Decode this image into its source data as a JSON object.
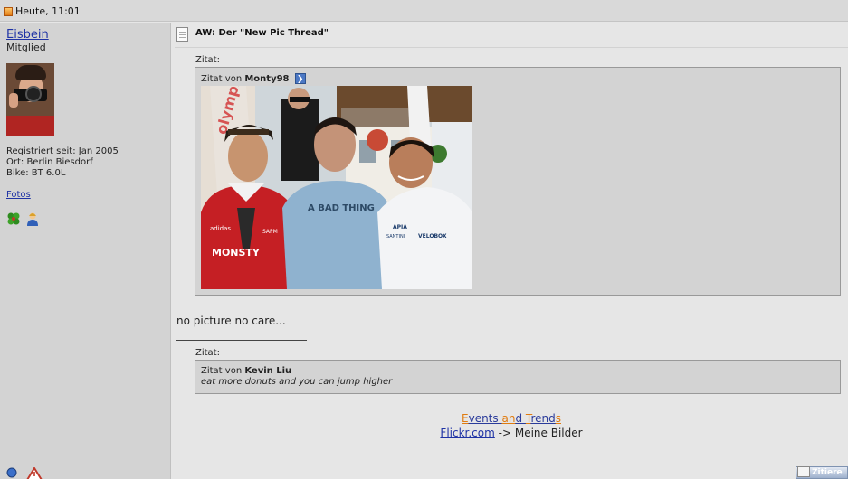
{
  "post_header": {
    "timestamp": "Heute, 11:01"
  },
  "user": {
    "name": "Eisbein",
    "rank": "Mitglied",
    "info": [
      "Registriert seit: Jan 2005",
      "Ort: Berlin Biesdorf",
      "Bike: BT 6.0L"
    ],
    "fotos_label": "Fotos"
  },
  "post": {
    "title": "AW: Der \"New Pic Thread\"",
    "quote1": {
      "label": "Zitat:",
      "prefix": "Zitat von",
      "author": "Monty98"
    },
    "body": "no picture no care...",
    "quote2": {
      "label": "Zitat:",
      "prefix": "Zitat von",
      "author": "Kevin Liu",
      "text": "eat more donuts and you can jump higher"
    }
  },
  "signature": {
    "events": [
      {
        "t": "E",
        "c": "#e07b0f"
      },
      {
        "t": "vents ",
        "c": "#2a3b9b"
      },
      {
        "t": "an",
        "c": "#e07b0f"
      },
      {
        "t": "d ",
        "c": "#2a3b9b"
      },
      {
        "t": "T",
        "c": "#e07b0f"
      },
      {
        "t": "rend",
        "c": "#2a3b9b"
      },
      {
        "t": "s",
        "c": "#e07b0f"
      }
    ],
    "flickr_link": "Flickr.com",
    "flickr_suffix": " -> Meine Bilder"
  },
  "buttons": {
    "quote_label": "Zitiere"
  },
  "photo_texts": {
    "shirt1_brand": "adidas",
    "shirt1_logo": "MONSTY",
    "shirt1_badge": "SAPM",
    "shirt2": "A BAD THING",
    "shirt3_logo1": "APIA",
    "shirt3_logo2": "VELOBOX",
    "shirt3_logo3": "SANTINI"
  }
}
